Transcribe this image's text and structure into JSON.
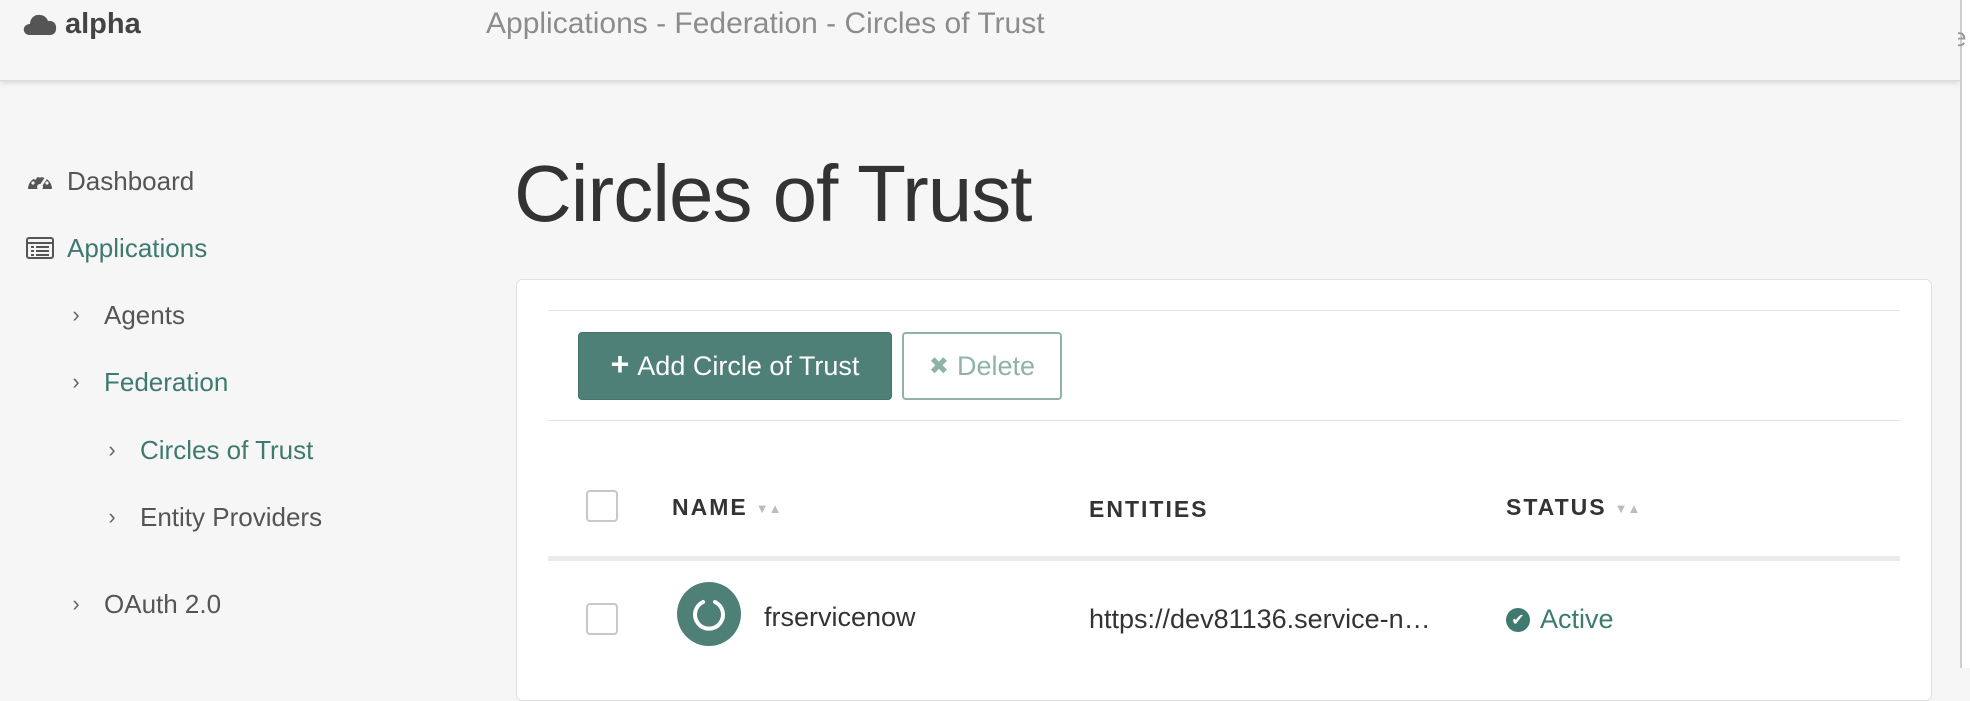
{
  "header": {
    "brand": "alpha",
    "breadcrumb": "Applications - Federation - Circles of Trust",
    "edge_char": "e"
  },
  "sidebar": {
    "dashboard": "Dashboard",
    "applications": "Applications",
    "agents": "Agents",
    "federation": "Federation",
    "circles_of_trust": "Circles of Trust",
    "entity_providers": "Entity Providers",
    "oauth": "OAuth 2.0"
  },
  "main": {
    "title": "Circles of Trust",
    "add_button": "Add Circle of Trust",
    "delete_button": "Delete"
  },
  "table": {
    "headers": {
      "name": "NAME",
      "entities": "ENTITIES",
      "status": "STATUS"
    },
    "rows": [
      {
        "name": "frservicenow",
        "entities": "https://dev81136.service-n…",
        "status": "Active"
      }
    ]
  },
  "colors": {
    "accent": "#3f7a70",
    "button": "#4f8078"
  }
}
